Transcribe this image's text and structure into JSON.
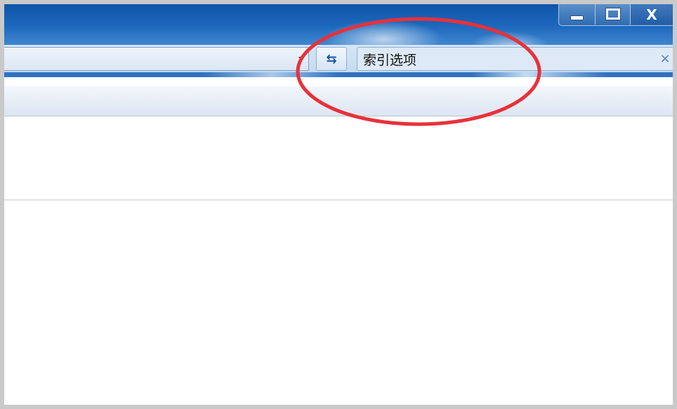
{
  "window": {
    "close_glyph": "X"
  },
  "addressbar": {
    "refresh_icon": "refresh-icon",
    "refresh_glyph": "⇆"
  },
  "search": {
    "value": "索引选项",
    "clear_glyph": "×"
  },
  "colors": {
    "titlebar": "#1b66bb",
    "annotation_circle": "#e8313a"
  }
}
